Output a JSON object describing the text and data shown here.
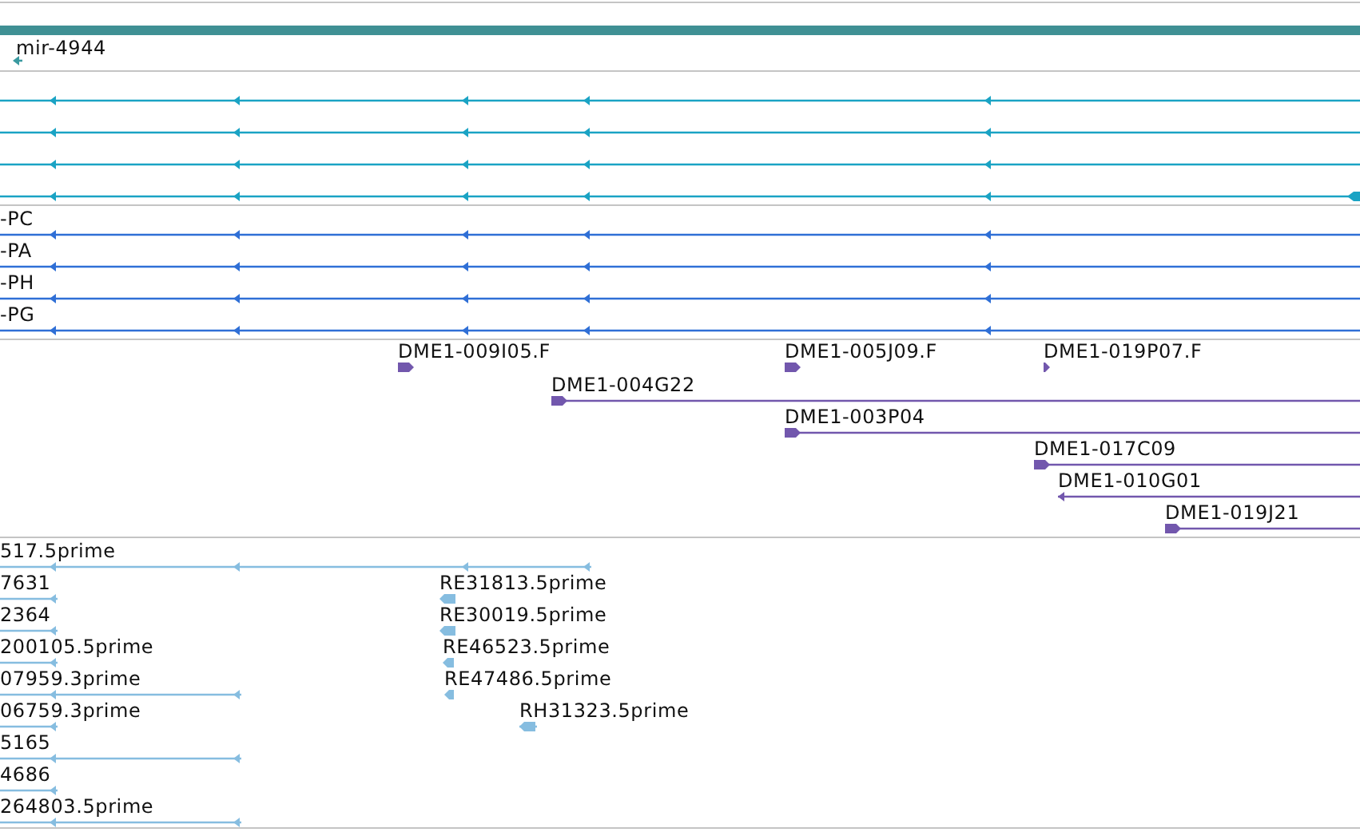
{
  "tracks": [
    {
      "color": "#3a9aa0",
      "features": [
        {
          "label": "mir-4944",
          "reverse": true
        }
      ]
    },
    {
      "color": "#1aa3c4",
      "features": [
        {
          "reverse": true
        },
        {
          "reverse": true
        },
        {
          "reverse": true
        },
        {
          "reverse": true
        }
      ]
    },
    {
      "color": "#2f6fd6",
      "features": [
        {
          "label": "-PC",
          "reverse": true
        },
        {
          "label": "-PA",
          "reverse": true
        },
        {
          "label": "-PH",
          "reverse": true
        },
        {
          "label": "-PG",
          "reverse": true
        }
      ]
    },
    {
      "color": "#7257ad",
      "features": [
        {
          "label": "DME1-009I05.F",
          "reverse": false
        },
        {
          "label": "DME1-005J09.F",
          "reverse": false
        },
        {
          "label": "DME1-019P07.F",
          "reverse": false
        },
        {
          "label": "DME1-004G22",
          "reverse": false
        },
        {
          "label": "DME1-003P04",
          "reverse": false
        },
        {
          "label": "DME1-017C09",
          "reverse": false
        },
        {
          "label": "DME1-010G01",
          "reverse": true
        },
        {
          "label": "DME1-019J21",
          "reverse": false
        }
      ]
    },
    {
      "color": "#86bde0",
      "features": [
        {
          "label": "517.5prime",
          "reverse": true
        },
        {
          "label": "7631",
          "reverse": true
        },
        {
          "label": "RE31813.5prime",
          "reverse": true
        },
        {
          "label": "2364",
          "reverse": true
        },
        {
          "label": "RE30019.5prime",
          "reverse": true
        },
        {
          "label": "200105.5prime",
          "reverse": true
        },
        {
          "label": "RE46523.5prime",
          "reverse": true
        },
        {
          "label": "07959.3prime",
          "reverse": true
        },
        {
          "label": "RE47486.5prime",
          "reverse": true
        },
        {
          "label": "06759.3prime",
          "reverse": true
        },
        {
          "label": "RH31323.5prime",
          "reverse": true
        },
        {
          "label": "5165",
          "reverse": true
        },
        {
          "label": "4686",
          "reverse": true
        },
        {
          "label": "264803.5prime",
          "reverse": true
        }
      ]
    }
  ]
}
